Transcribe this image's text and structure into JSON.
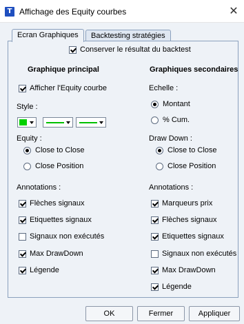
{
  "window": {
    "title": "Affichage des Equity courbes",
    "icon_letter": "T"
  },
  "tabs": [
    {
      "label": "Ecran Graphiques",
      "active": true
    },
    {
      "label": "Backtesting stratégies",
      "active": false
    }
  ],
  "keep_result": {
    "label": "Conserver le résultat du backtest",
    "checked": true
  },
  "left": {
    "heading": "Graphique principal",
    "show_equity": {
      "label": "Afficher l'Equity courbe",
      "checked": true
    },
    "style_label": "Style :",
    "style_colors": {
      "main": "#00d000",
      "line1": "#00c000",
      "line2": "#00c000"
    },
    "equity_label": "Equity :",
    "equity_options": [
      {
        "label": "Close to Close",
        "checked": true
      },
      {
        "label": "Close Position",
        "checked": false
      }
    ],
    "annotations_label": "Annotations :",
    "annotations": [
      {
        "label": "Flèches signaux",
        "checked": true
      },
      {
        "label": "Etiquettes signaux",
        "checked": true
      },
      {
        "label": "Signaux non exécutés",
        "checked": false
      },
      {
        "label": "Max DrawDown",
        "checked": true
      },
      {
        "label": "Légende",
        "checked": true
      }
    ]
  },
  "right": {
    "heading": "Graphiques secondaires",
    "scale_label": "Echelle :",
    "scale_options": [
      {
        "label": "Montant",
        "checked": true
      },
      {
        "label": "% Cum.",
        "checked": false
      }
    ],
    "drawdown_label": "Draw Down :",
    "drawdown_options": [
      {
        "label": "Close to Close",
        "checked": true
      },
      {
        "label": "Close Position",
        "checked": false
      }
    ],
    "annotations_label": "Annotations :",
    "annotations": [
      {
        "label": "Marqueurs prix",
        "checked": true
      },
      {
        "label": "Flèches signaux",
        "checked": true
      },
      {
        "label": "Etiquettes signaux",
        "checked": true
      },
      {
        "label": "Signaux non exécutés",
        "checked": false
      },
      {
        "label": "Max DrawDown",
        "checked": true
      },
      {
        "label": "Légende",
        "checked": true
      }
    ]
  },
  "buttons": {
    "ok": "OK",
    "close": "Fermer",
    "apply": "Appliquer"
  }
}
